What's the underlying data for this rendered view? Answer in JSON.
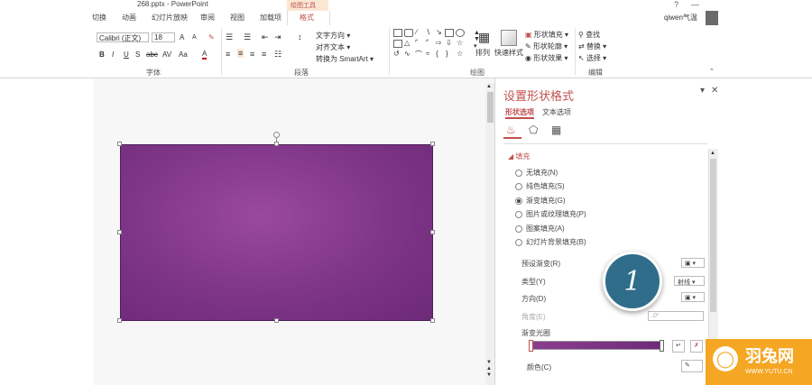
{
  "window": {
    "title": "268.pptx - PowerPoint",
    "context_tools": "绘图工具",
    "help": "?",
    "user": "qiwen气温"
  },
  "tabs": [
    "切换",
    "动画",
    "幻灯片放映",
    "审阅",
    "视图",
    "加载项",
    "格式"
  ],
  "ribbon": {
    "font_name": "Calibri (正文)",
    "font_size": "18",
    "grow_font": "A",
    "shrink_font": "A",
    "bold": "B",
    "italic": "I",
    "underline": "U",
    "shadow": "S",
    "strike": "abc",
    "spacing": "AV",
    "case": "Aa",
    "font_color": "A",
    "text_direction": "文字方向",
    "align_text": "对齐文本",
    "smartart": "转换为 SmartArt",
    "arrange": "排列",
    "quick_styles": "快速样式",
    "shape_fill": "形状填充",
    "shape_outline": "形状轮廓",
    "shape_effects": "形状效果",
    "find": "查找",
    "replace": "替换",
    "select": "选择",
    "group_font": "字体",
    "group_paragraph": "段落",
    "group_drawing": "绘图",
    "group_editing": "编辑"
  },
  "pane": {
    "title": "设置形状格式",
    "tab_shape": "形状选项",
    "tab_text": "文本选项",
    "section_fill": "填充",
    "fill_options": [
      {
        "label": "无填充(N)",
        "selected": false
      },
      {
        "label": "纯色填充(S)",
        "selected": false
      },
      {
        "label": "渐变填充(G)",
        "selected": true
      },
      {
        "label": "图片或纹理填充(P)",
        "selected": false
      },
      {
        "label": "图案填充(A)",
        "selected": false
      },
      {
        "label": "幻灯片背景填充(B)",
        "selected": false
      }
    ],
    "preset_gradient": "预设渐变(R)",
    "type_label": "类型(Y)",
    "type_value": "射线",
    "direction_label": "方向(D)",
    "angle_label": "角度(E)",
    "angle_value": ".0°",
    "gradient_stops": "渐变光圈",
    "color_label": "颜色(C)"
  },
  "badge": {
    "number": "1"
  },
  "logo": {
    "name": "羽兔网",
    "url": "WWW.YUTU.CN"
  },
  "colors": {
    "accent": "#c0504d",
    "shape_fill": "#7e3587",
    "badge": "#2f6d8a",
    "logo": "#f5a623"
  }
}
